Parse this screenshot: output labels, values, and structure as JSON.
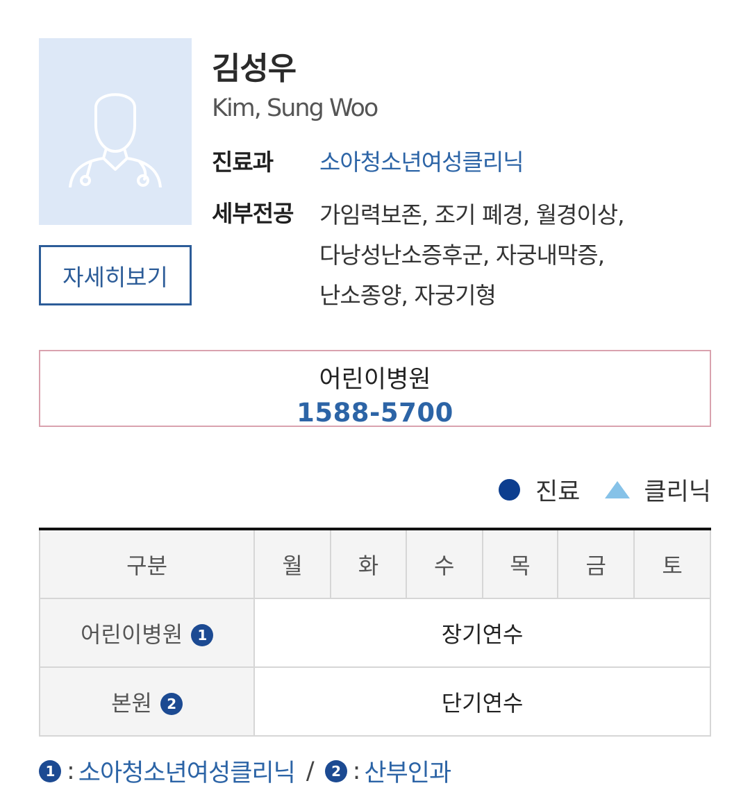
{
  "doctor": {
    "name_ko": "김성우",
    "name_en": "Kim, Sung Woo",
    "photo_icon": "doctor-silhouette-icon",
    "detail_button": "자세히보기"
  },
  "info": {
    "department_label": "진료과",
    "department_value": "소아청소년여성클리닉",
    "specialty_label": "세부전공",
    "specialty_lines": [
      "가임력보존, 조기 폐경, 월경이상,",
      "다낭성난소증후군, 자궁내막증,",
      "난소종양, 자궁기형"
    ]
  },
  "contact": {
    "hospital": "어린이병원",
    "phone": "1588-5700"
  },
  "legend": {
    "treatment": "진료",
    "clinic": "클리닉"
  },
  "schedule": {
    "headers": [
      "구분",
      "월",
      "화",
      "수",
      "목",
      "금",
      "토"
    ],
    "rows": [
      {
        "label": "어린이병원",
        "badge": "1",
        "status": "장기연수"
      },
      {
        "label": "본원",
        "badge": "2",
        "status": "단기연수"
      }
    ]
  },
  "footnotes": [
    {
      "badge": "1",
      "text": "소아청소년여성클리닉"
    },
    {
      "badge": "2",
      "text": "산부인과"
    }
  ],
  "colors": {
    "accent_blue": "#2c64a6",
    "dark_blue": "#1c4a92",
    "photo_bg": "#dde8f7",
    "phone_border": "#d9a2ae",
    "clinic_triangle": "#86c2e8"
  }
}
